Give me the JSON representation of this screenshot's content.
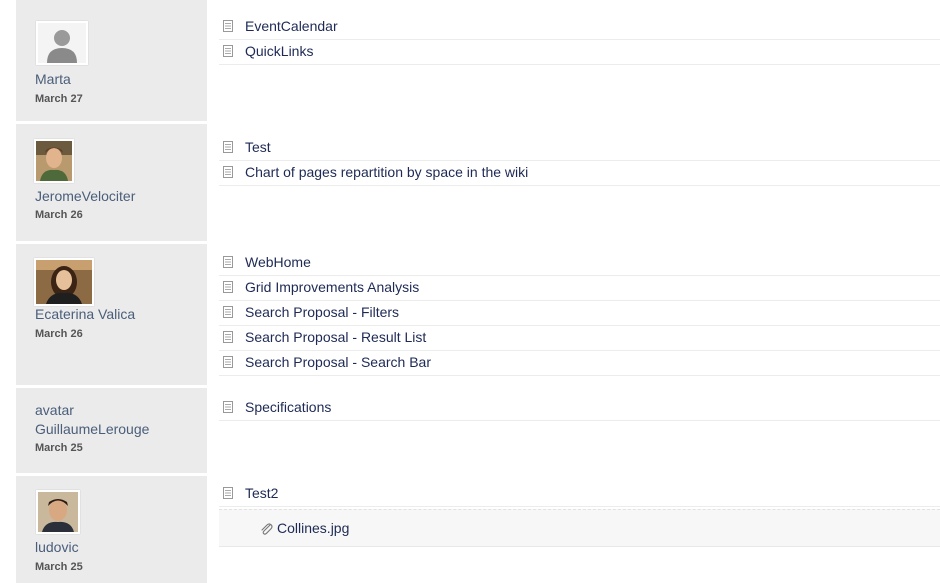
{
  "activity": [
    {
      "user": "Marta",
      "date": "March 27",
      "avatar_icon": "default-user-silhouette",
      "documents": [
        "EventCalendar",
        "QuickLinks"
      ]
    },
    {
      "user": "JeromeVelociter",
      "date": "March 26",
      "avatar_icon": "user-photo",
      "documents": [
        "Test",
        "Chart of pages repartition by space in the wiki"
      ]
    },
    {
      "user": "Ecaterina Valica",
      "date": "March 26",
      "avatar_icon": "user-photo",
      "documents": [
        "WebHome",
        "Grid Improvements Analysis",
        "Search Proposal - Filters",
        "Search Proposal - Result List",
        "Search Proposal - Search Bar"
      ]
    },
    {
      "user": "GuillaumeLerouge",
      "avatar_alt": "avatar",
      "date": "March 25",
      "documents": [
        "Specifications"
      ]
    },
    {
      "user": "ludovic",
      "date": "March 25",
      "avatar_icon": "user-photo",
      "documents": [
        "Test2"
      ],
      "attachments": [
        "Collines.jpg"
      ]
    }
  ],
  "icons": {
    "document": "page-icon",
    "attachment": "paperclip-icon"
  },
  "colors": {
    "link": "#1e2a55",
    "user_name": "#4a5e7a",
    "user_column_bg": "#ebebeb"
  }
}
